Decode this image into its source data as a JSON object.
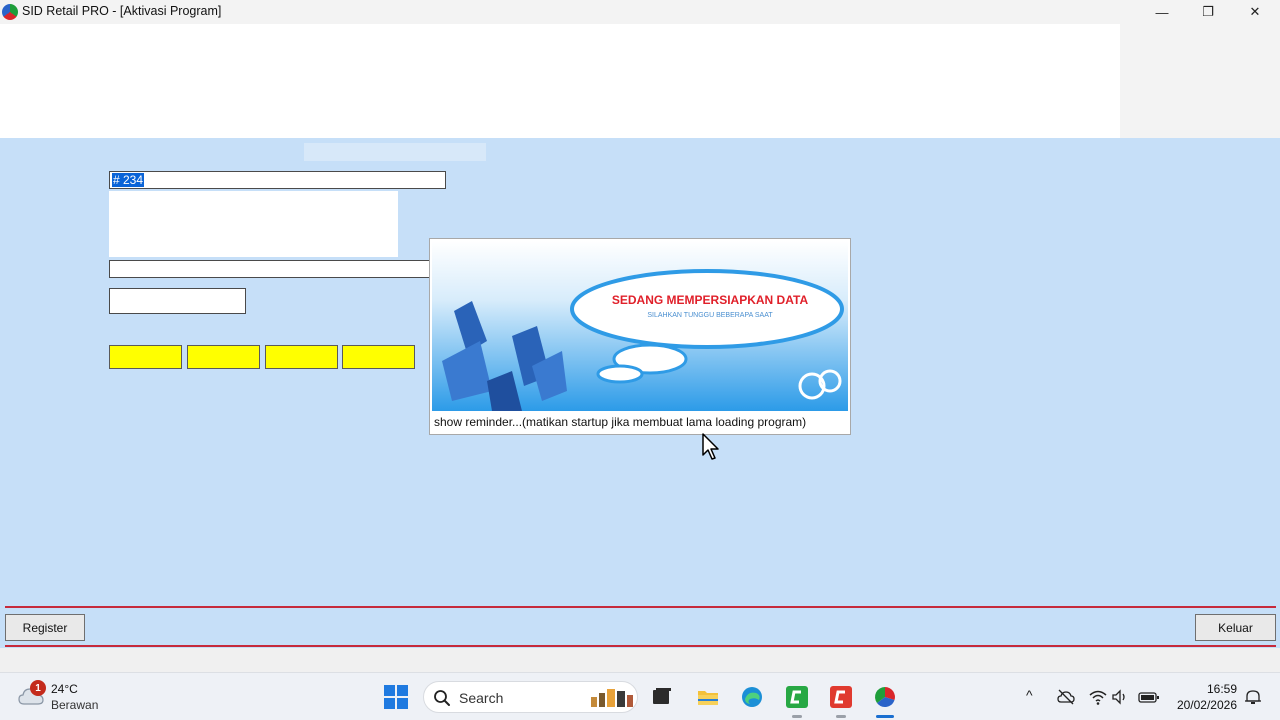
{
  "window": {
    "title": "SID Retail PRO - [Aktivasi Program]",
    "minimize_glyph": "—",
    "maximize_glyph": "❐",
    "close_glyph": "✕"
  },
  "form": {
    "serial_value": "# 234",
    "key_boxes": [
      "",
      "",
      "",
      ""
    ],
    "key_box_color": "#ffff00"
  },
  "splash": {
    "heading": "SEDANG MEMPERSIAPKAN DATA",
    "subheading": "SILAHKAN TUNGGU BEBERAPA SAAT",
    "footer": "show reminder...(matikan startup jika membuat lama loading program)",
    "heading_color": "#e0202a"
  },
  "buttons": {
    "register": "Register",
    "keluar": "Keluar"
  },
  "colors": {
    "form_background": "#c6dff8",
    "divider_red": "#c62a3c"
  },
  "taskbar": {
    "weather": {
      "badge": "1",
      "temperature": "24°C",
      "description": "Berawan",
      "icon": "cloud-icon"
    },
    "search_label": "Search",
    "pinned": [
      "windows-start-icon",
      "task-view-icon",
      "file-explorer-icon",
      "edge-icon",
      "green-app-icon",
      "red-app-icon",
      "sid-retail-icon"
    ],
    "tray": {
      "chevron": "^",
      "icons": [
        "cloud-offline-icon",
        "wifi-icon",
        "volume-icon",
        "battery-icon",
        "notification-icon"
      ],
      "time": "16:59",
      "date": "20/02/2026"
    }
  }
}
